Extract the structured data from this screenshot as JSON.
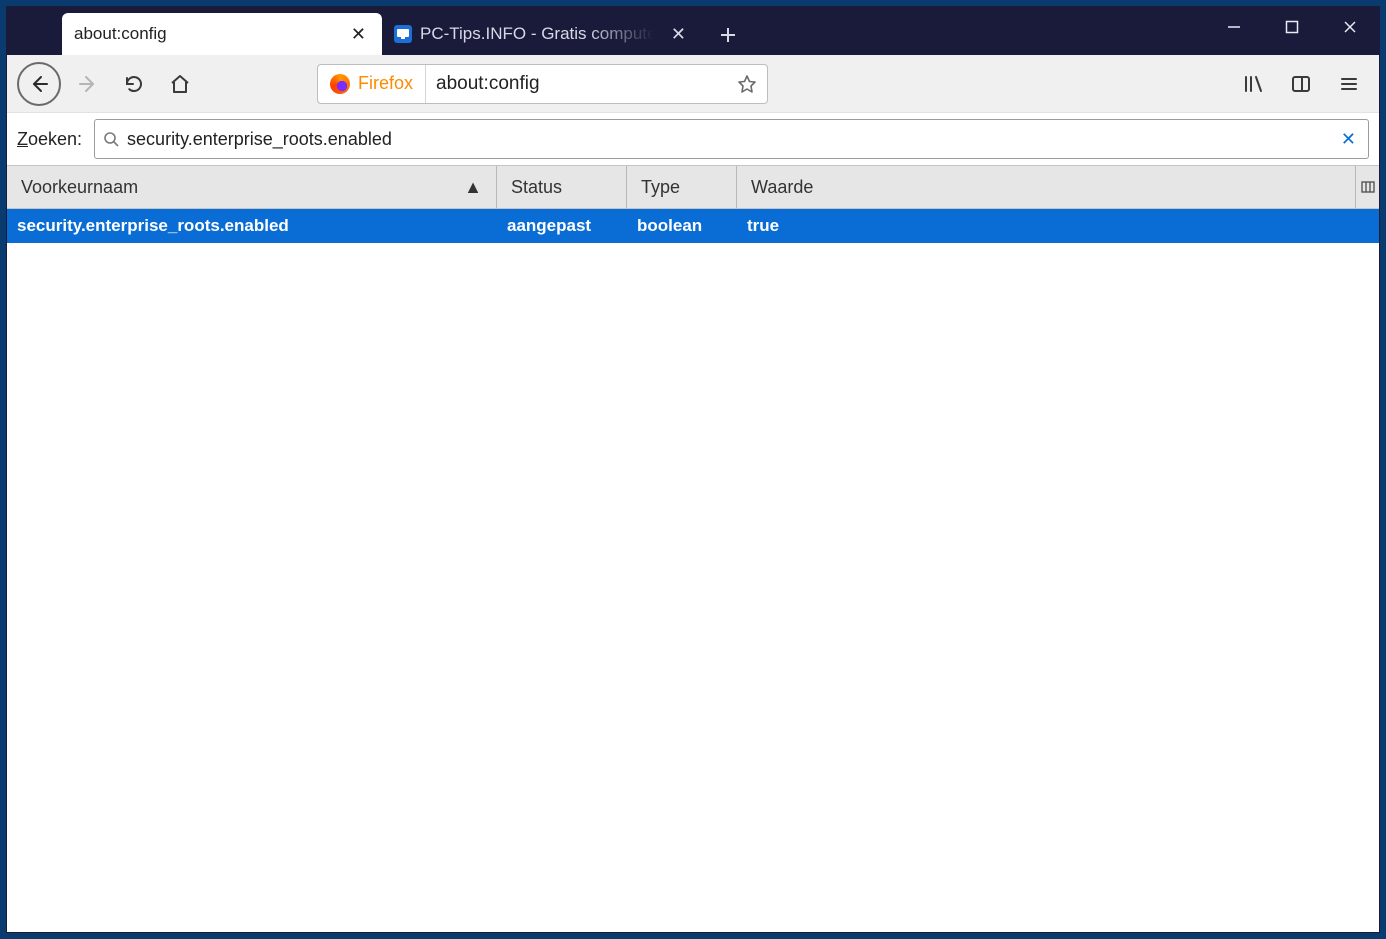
{
  "tabs": [
    {
      "title": "about:config",
      "active": true
    },
    {
      "title": "PC-Tips.INFO - Gratis compute",
      "active": false
    }
  ],
  "urlbar": {
    "brand": "Firefox",
    "value": "about:config"
  },
  "search": {
    "label_prefix": "Z",
    "label_suffix": "oeken:",
    "value": "security.enterprise_roots.enabled"
  },
  "columns": {
    "name": "Voorkeurnaam",
    "status": "Status",
    "type": "Type",
    "value": "Waarde"
  },
  "rows": [
    {
      "name": "security.enterprise_roots.enabled",
      "status": "aangepast",
      "type": "boolean",
      "value": "true",
      "selected": true
    }
  ]
}
